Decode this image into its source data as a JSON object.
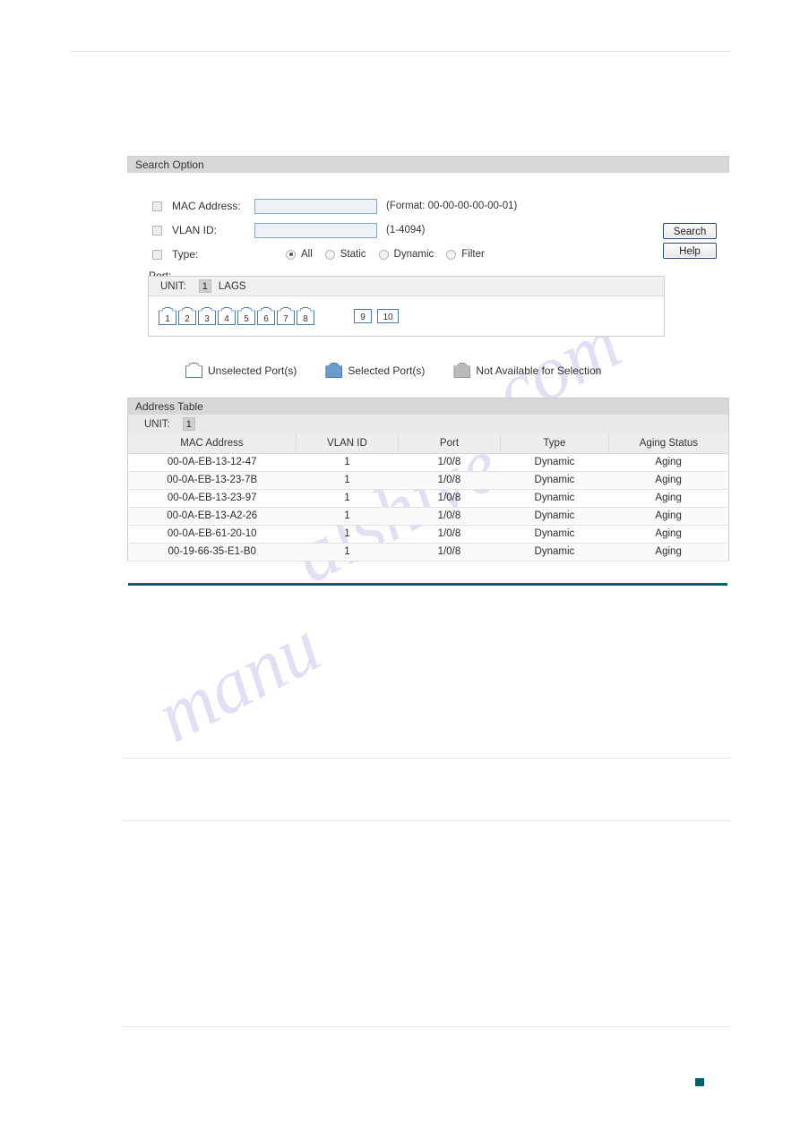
{
  "page": {
    "corner_marker_color": "#04606a",
    "divider_color": "#04606a"
  },
  "watermark": {
    "line1": "com",
    "line2": "alshive",
    "line3": "manu"
  },
  "search_option": {
    "title": "Search Option",
    "mac": {
      "label": "MAC Address:",
      "value": "",
      "placeholder": "",
      "hint": "(Format: 00-00-00-00-00-01)"
    },
    "vlan": {
      "label": "VLAN ID:",
      "value": "",
      "placeholder": "",
      "hint": "(1-4094)"
    },
    "type": {
      "label": "Type:",
      "options": [
        {
          "label": "All",
          "checked": true
        },
        {
          "label": "Static",
          "checked": false
        },
        {
          "label": "Dynamic",
          "checked": false
        },
        {
          "label": "Filter",
          "checked": false
        }
      ]
    },
    "buttons": {
      "search": "Search",
      "help": "Help"
    },
    "port_caption": "Port:"
  },
  "port_panel": {
    "unit_label": "UNIT:",
    "unit_value": "1",
    "lags_label": "LAGS",
    "rj45_ports": [
      "1",
      "2",
      "3",
      "4",
      "5",
      "6",
      "7",
      "8"
    ],
    "sfp_ports": [
      "9",
      "10"
    ]
  },
  "legend": {
    "items": [
      {
        "label": "Unselected Port(s)",
        "color": "#ffffff",
        "border": "#4a7aa8"
      },
      {
        "label": "Selected Port(s)",
        "color": "#6a9bd1",
        "border": "#4a7aa8"
      },
      {
        "label": "Not Available for Selection",
        "color": "#b9b9b9",
        "border": "#9a9a9a"
      }
    ]
  },
  "address_table": {
    "title": "Address Table",
    "unit_label": "UNIT:",
    "unit_value": "1",
    "columns": [
      "MAC Address",
      "VLAN ID",
      "Port",
      "Type",
      "Aging Status"
    ],
    "rows": [
      {
        "mac": "00-0A-EB-13-12-47",
        "vlan": "1",
        "port": "1/0/8",
        "type": "Dynamic",
        "aging": "Aging"
      },
      {
        "mac": "00-0A-EB-13-23-7B",
        "vlan": "1",
        "port": "1/0/8",
        "type": "Dynamic",
        "aging": "Aging"
      },
      {
        "mac": "00-0A-EB-13-23-97",
        "vlan": "1",
        "port": "1/0/8",
        "type": "Dynamic",
        "aging": "Aging"
      },
      {
        "mac": "00-0A-EB-13-A2-26",
        "vlan": "1",
        "port": "1/0/8",
        "type": "Dynamic",
        "aging": "Aging"
      },
      {
        "mac": "00-0A-EB-61-20-10",
        "vlan": "1",
        "port": "1/0/8",
        "type": "Dynamic",
        "aging": "Aging"
      },
      {
        "mac": "00-19-66-35-E1-B0",
        "vlan": "1",
        "port": "1/0/8",
        "type": "Dynamic",
        "aging": "Aging"
      }
    ]
  }
}
